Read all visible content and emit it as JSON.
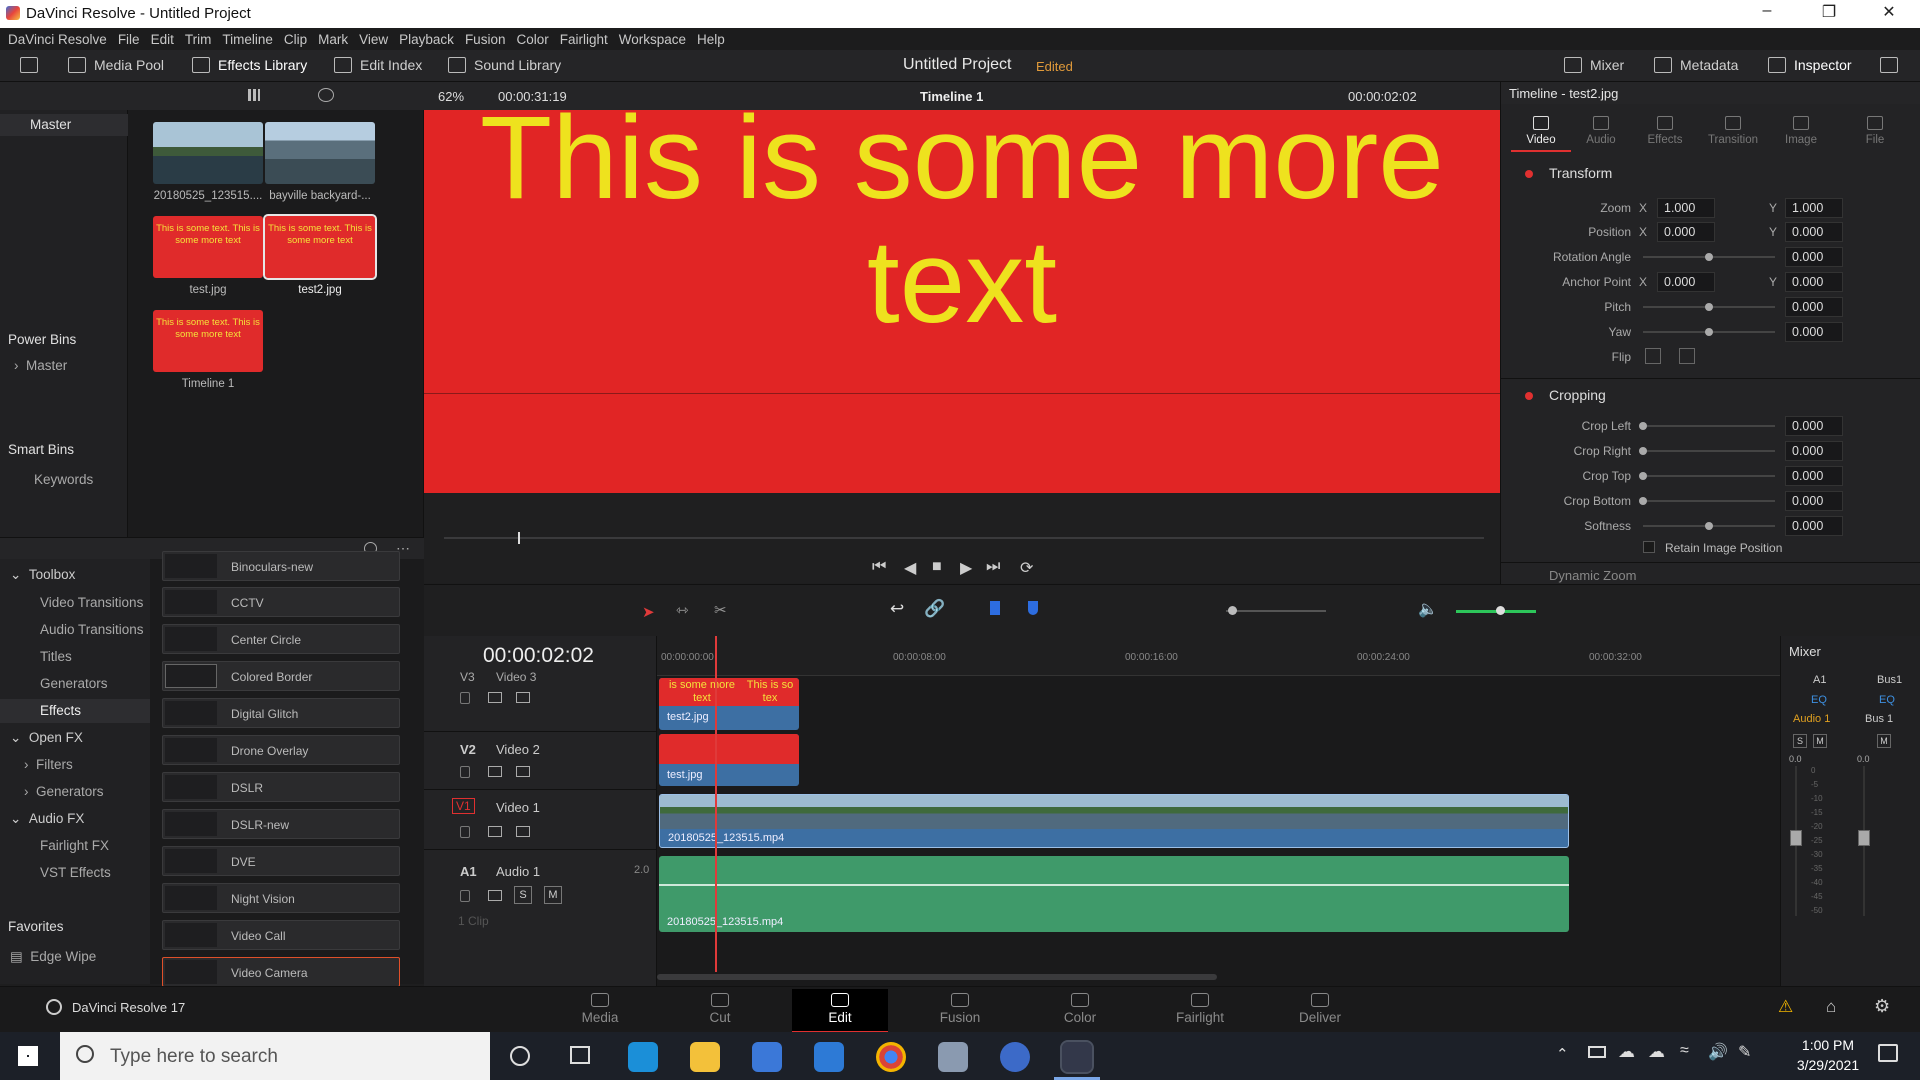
{
  "window": {
    "title": "DaVinci Resolve - Untitled Project"
  },
  "menu": [
    "DaVinci Resolve",
    "File",
    "Edit",
    "Trim",
    "Timeline",
    "Clip",
    "Mark",
    "View",
    "Playback",
    "Fusion",
    "Color",
    "Fairlight",
    "Workspace",
    "Help"
  ],
  "toolbar": {
    "media_pool": "Media Pool",
    "effects_library": "Effects Library",
    "edit_index": "Edit Index",
    "sound_library": "Sound Library",
    "project_title": "Untitled Project",
    "project_status": "Edited",
    "mixer": "Mixer",
    "metadata": "Metadata",
    "inspector": "Inspector"
  },
  "bins": {
    "master": "Master",
    "power_bins": "Power Bins",
    "power_master": "Master",
    "smart_bins": "Smart Bins",
    "keywords": "Keywords"
  },
  "media": [
    {
      "name": "20180525_123515....",
      "kind": "video"
    },
    {
      "name": "bayville backyard-...",
      "kind": "video"
    },
    {
      "name": "test.jpg",
      "kind": "image",
      "text": "This is some text. This is some more text"
    },
    {
      "name": "test2.jpg",
      "kind": "image",
      "text": "This is some text. This is some more text"
    },
    {
      "name": "Timeline 1",
      "kind": "timeline",
      "text": "This is some text. This is some more text"
    }
  ],
  "effects_tree": {
    "toolbox": "Toolbox",
    "video_transitions": "Video Transitions",
    "audio_transitions": "Audio Transitions",
    "titles": "Titles",
    "generators": "Generators",
    "effects": "Effects",
    "open_fx": "Open FX",
    "filters": "Filters",
    "ofx_generators": "Generators",
    "audio_fx": "Audio FX",
    "fairlight_fx": "Fairlight FX",
    "vst_effects": "VST Effects",
    "favorites": "Favorites",
    "edge_wipe": "Edge Wipe"
  },
  "effects_list": [
    "Binoculars-new",
    "CCTV",
    "Center Circle",
    "Colored Border",
    "Digital Glitch",
    "Drone Overlay",
    "DSLR",
    "DSLR-new",
    "DVE",
    "Night Vision",
    "Video Call",
    "Video Camera"
  ],
  "viewer": {
    "zoom": "62%",
    "source_tc": "00:00:31:19",
    "timeline_name": "Timeline 1",
    "record_tc": "00:00:02:02",
    "frame_text_line1": "This is some more",
    "frame_text_line2": "text"
  },
  "inspector": {
    "title": "Timeline - test2.jpg",
    "tabs": [
      "Video",
      "Audio",
      "Effects",
      "Transition",
      "Image",
      "File"
    ],
    "transform": "Transform",
    "zoom_label": "Zoom",
    "zoom_x": "1.000",
    "zoom_y": "1.000",
    "position_label": "Position",
    "position_x": "0.000",
    "position_y": "0.000",
    "rotation_label": "Rotation Angle",
    "rotation": "0.000",
    "anchor_label": "Anchor Point",
    "anchor_x": "0.000",
    "anchor_y": "0.000",
    "pitch_label": "Pitch",
    "pitch": "0.000",
    "yaw_label": "Yaw",
    "yaw": "0.000",
    "flip_label": "Flip",
    "cropping": "Cropping",
    "crop_left_label": "Crop Left",
    "crop_left": "0.000",
    "crop_right_label": "Crop Right",
    "crop_right": "0.000",
    "crop_top_label": "Crop Top",
    "crop_top": "0.000",
    "crop_bottom_label": "Crop Bottom",
    "crop_bottom": "0.000",
    "softness_label": "Softness",
    "softness": "0.000",
    "retain": "Retain Image Position",
    "dynamic_zoom": "Dynamic Zoom",
    "x": "X",
    "y": "Y"
  },
  "timeline": {
    "timecode": "00:00:02:02",
    "ruler": [
      "00:00:00:00",
      "00:00:08:00",
      "00:00:16:00",
      "00:00:24:00",
      "00:00:32:00"
    ],
    "tracks": [
      {
        "id": "V3",
        "name": "Video 3"
      },
      {
        "id": "V2",
        "name": "Video 2"
      },
      {
        "id": "V1",
        "name": "Video 1"
      },
      {
        "id": "A1",
        "name": "Audio 1",
        "ch": "2.0",
        "clips": "1 Clip"
      }
    ],
    "clips": {
      "v3": "test2.jpg",
      "v2": "test.jpg",
      "v1": "20180525_123515.mp4",
      "a1": "20180525_123515.mp4",
      "v3_text_a": "is some more text",
      "v3_text_b": "This is so tex"
    }
  },
  "mixer": {
    "title": "Mixer",
    "a1": "A1",
    "bus1": "Bus1",
    "eq": "EQ",
    "audio1": "Audio 1",
    "bus1_label": "Bus 1",
    "s": "S",
    "m": "M",
    "level_a": "0.0",
    "level_b": "0.0",
    "scale": [
      "0",
      "-5",
      "-10",
      "-15",
      "-20",
      "-25",
      "-30",
      "-35",
      "-40",
      "-45",
      "-50"
    ]
  },
  "pages": [
    "Media",
    "Cut",
    "Edit",
    "Fusion",
    "Color",
    "Fairlight",
    "Deliver"
  ],
  "active_page": "Edit",
  "app_version": "DaVinci Resolve 17",
  "taskbar": {
    "search_placeholder": "Type here to search",
    "time": "1:00 PM",
    "date": "3/29/2021"
  },
  "colors": {
    "accent_red": "#e03030",
    "clip_blue": "#3d6fa3",
    "audio_green": "#3f9a6a",
    "title_yellow": "#eee21e"
  }
}
